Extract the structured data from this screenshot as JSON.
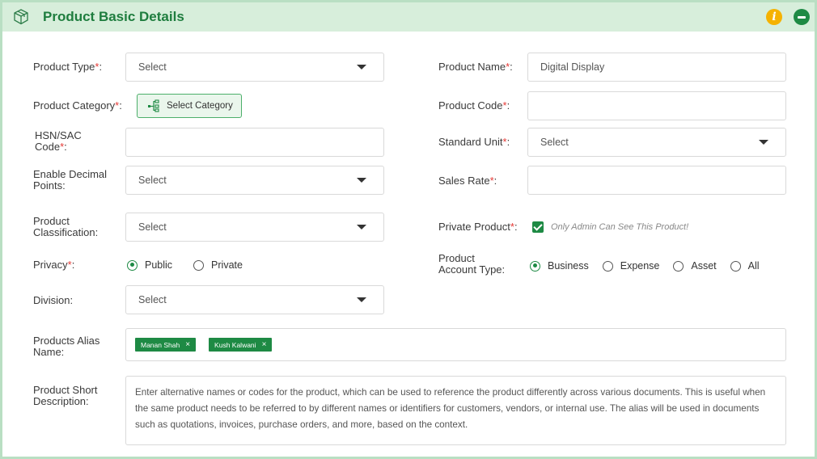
{
  "header": {
    "title": "Product Basic Details"
  },
  "labels": {
    "product_type": "Product Type",
    "product_category": "Product Category",
    "hsn_line1": "HSN/SAC",
    "hsn_line2": "Code",
    "decimal_line1": "Enable Decimal",
    "decimal_line2": "Points:",
    "classification_line1": "Product",
    "classification_line2": "Classification:",
    "privacy": "Privacy",
    "division": "Division:",
    "alias_line1": "Products Alias",
    "alias_line2": "Name:",
    "short_desc_line1": "Product Short",
    "short_desc_line2": "Description:",
    "product_name": "Product Name",
    "product_code": "Product Code",
    "standard_unit": "Standard Unit",
    "sales_rate": "Sales Rate",
    "private_product": "Private Product",
    "account_type_line1": "Product",
    "account_type_line2": "Account Type:",
    "required_mark": "*",
    "colon": ":"
  },
  "fields": {
    "product_type": "Select",
    "decimal_points": "Select",
    "classification": "Select",
    "division": "Select",
    "product_name": "Digital Display",
    "standard_unit": "Select",
    "hsn_code": "",
    "product_code": "",
    "sales_rate": ""
  },
  "select_category_label": "Select Category",
  "private_product_checkbox": {
    "checked": true,
    "label": "Only Admin Can See This Product!"
  },
  "privacy_options": [
    {
      "label": "Public",
      "selected": true
    },
    {
      "label": "Private",
      "selected": false
    }
  ],
  "account_type_options": [
    {
      "label": "Business",
      "selected": true
    },
    {
      "label": "Expense",
      "selected": false
    },
    {
      "label": "Asset",
      "selected": false
    },
    {
      "label": "All",
      "selected": false
    }
  ],
  "alias_tags": [
    {
      "label": "Manan Shah",
      "remove": "×"
    },
    {
      "label": "Kush Kalwani",
      "remove": "×"
    }
  ],
  "short_description": "Enter alternative names or codes for the product, which can be used to reference the product differently across various documents. This is useful when the same product needs to be referred to by different names or identifiers for customers, vendors, or internal use. The alias will be used in documents such as quotations, invoices, purchase orders, and more, based on the context.",
  "colors": {
    "brand_green": "#1e8a44",
    "header_bg": "#d7eedb",
    "info": "#f5b200",
    "required": "#e53935"
  },
  "icons": {
    "header": "box-icon",
    "info": "info-icon",
    "collapse": "minus-circle-icon",
    "category": "tree-icon"
  }
}
